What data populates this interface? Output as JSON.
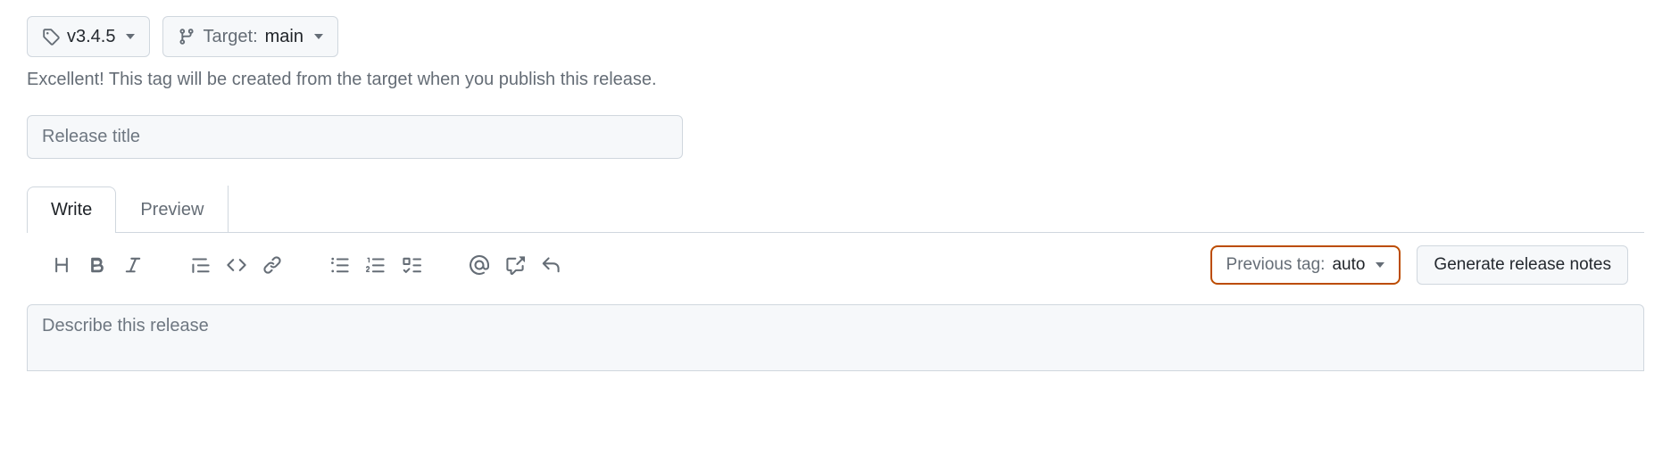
{
  "tag_selector": {
    "value": "v3.4.5"
  },
  "target_selector": {
    "label": "Target:",
    "value": "main"
  },
  "hint": "Excellent! This tag will be created from the target when you publish this release.",
  "title_input": {
    "placeholder": "Release title",
    "value": ""
  },
  "tabs": {
    "write": "Write",
    "preview": "Preview"
  },
  "previous_tag": {
    "label": "Previous tag:",
    "value": "auto"
  },
  "generate_button": "Generate release notes",
  "description": {
    "placeholder": "Describe this release",
    "value": ""
  }
}
